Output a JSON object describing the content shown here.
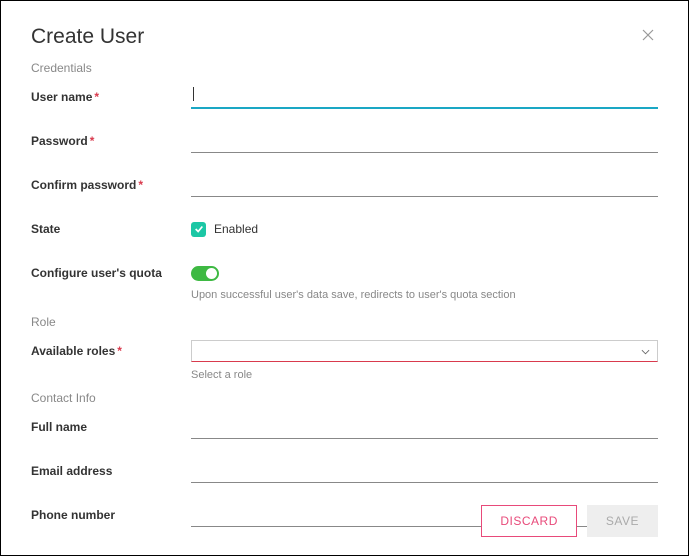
{
  "dialog": {
    "title": "Create User"
  },
  "sections": {
    "credentials": "Credentials",
    "role": "Role",
    "contact": "Contact Info"
  },
  "labels": {
    "username": "User name",
    "password": "Password",
    "confirm_password": "Confirm password",
    "state": "State",
    "configure_quota": "Configure user's quota",
    "available_roles": "Available roles",
    "full_name": "Full name",
    "email": "Email address",
    "phone": "Phone number"
  },
  "values": {
    "username": "",
    "password": "",
    "confirm_password": "",
    "state_enabled_label": "Enabled",
    "quota_helper": "Upon successful user's data save, redirects to user's quota section",
    "roles_helper": "Select a role",
    "full_name": "",
    "email": "",
    "phone": ""
  },
  "buttons": {
    "discard": "DISCARD",
    "save": "SAVE"
  }
}
